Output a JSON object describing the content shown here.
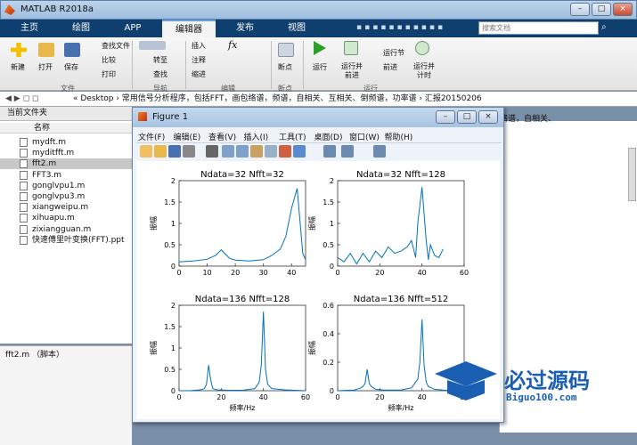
{
  "window": {
    "title": "MATLAB R2018a",
    "buttons": [
      "–",
      "□",
      "×"
    ]
  },
  "tabs": [
    "主页",
    "绘图",
    "APP",
    "编辑器",
    "发布",
    "视图"
  ],
  "search": {
    "placeholder": "搜索文档"
  },
  "ribbon": {
    "file": {
      "new": "新建",
      "open": "打开",
      "save": "保存",
      "find_files": "查找文件",
      "compare": "比较",
      "print": "打印",
      "group": "文件"
    },
    "nav": {
      "goto": "转至",
      "find": "查找",
      "group": "导航"
    },
    "edit": {
      "insert": "插入",
      "comment": "注释",
      "indent": "缩进",
      "group": "编辑"
    },
    "breakpoints": {
      "label": "断点",
      "group": "断点"
    },
    "run": {
      "run": "运行",
      "run_advance": "运行并\n前进",
      "run_section": "运行节",
      "advance": "前进",
      "run_time": "运行并\n计时",
      "group": "运行"
    }
  },
  "address": "« Desktop › 常用信号分析程序，包括FFT，画包络谱，频谱，自相关、互相关、倒频谱，功率谱 › 汇报20150206",
  "current_folder": {
    "title": "当前文件夹",
    "col": "名称",
    "files": [
      "mydft.m",
      "myditfft.m",
      "fft2.m",
      "FFT3.m",
      "gonglvpu1.m",
      "gonglvpu3.m",
      "xiangweipu.m",
      "xihuapu.m",
      "zixiangguan.m",
      "快速傅里叶变换(FFT).ppt"
    ],
    "selected": 2,
    "details": "fft2.m （脚本）"
  },
  "right_snippet": "络谱，自相关、",
  "figure": {
    "title": "Figure 1",
    "menu": [
      "文件(F)",
      "编辑(E)",
      "查看(V)",
      "插入(I)",
      "工具(T)",
      "桌面(D)",
      "窗口(W)",
      "帮助(H)"
    ]
  },
  "chart_data": [
    {
      "type": "line",
      "title": "Ndata=32 Nfft=32",
      "xlabel": "",
      "ylabel": "振幅",
      "xlim": [
        0,
        45
      ],
      "ylim": [
        0,
        2
      ],
      "xticks": [
        0,
        10,
        20,
        30,
        40
      ],
      "yticks": [
        0,
        0.5,
        1,
        1.5,
        2
      ],
      "series": [
        {
          "x": [
            0,
            5,
            10,
            13,
            15,
            18,
            20,
            25,
            30,
            33,
            36,
            38,
            40,
            42,
            44,
            45
          ],
          "y": [
            0.1,
            0.12,
            0.16,
            0.25,
            0.38,
            0.18,
            0.14,
            0.12,
            0.15,
            0.25,
            0.4,
            0.7,
            1.35,
            1.82,
            0.3,
            0.15
          ]
        }
      ]
    },
    {
      "type": "line",
      "title": "Ndata=32 Nfft=128",
      "xlabel": "",
      "ylabel": "振幅",
      "xlim": [
        0,
        60
      ],
      "ylim": [
        0,
        2
      ],
      "xticks": [
        0,
        20,
        40,
        60
      ],
      "yticks": [
        0,
        0.5,
        1,
        1.5,
        2
      ],
      "series": [
        {
          "x": [
            0,
            3,
            6,
            9,
            12,
            15,
            18,
            21,
            24,
            27,
            30,
            33,
            35,
            37,
            38,
            40,
            42,
            43,
            44,
            46,
            48,
            50
          ],
          "y": [
            0.2,
            0.1,
            0.3,
            0.05,
            0.3,
            0.1,
            0.35,
            0.2,
            0.45,
            0.3,
            0.35,
            0.45,
            0.6,
            0.2,
            1.0,
            1.85,
            0.6,
            0.15,
            0.5,
            0.25,
            0.2,
            0.4
          ]
        }
      ]
    },
    {
      "type": "line",
      "title": "Ndata=136 Nfft=128",
      "xlabel": "频率/Hz",
      "ylabel": "振幅",
      "xlim": [
        0,
        60
      ],
      "ylim": [
        0,
        2
      ],
      "xticks": [
        0,
        20,
        40,
        60
      ],
      "yticks": [
        0,
        0.5,
        1,
        1.5,
        2
      ],
      "series": [
        {
          "x": [
            0,
            5,
            10,
            12,
            13,
            14,
            15,
            16,
            18,
            25,
            30,
            36,
            38,
            39,
            40,
            41,
            42,
            44,
            50,
            60
          ],
          "y": [
            0,
            0,
            0.02,
            0.05,
            0.15,
            0.6,
            0.25,
            0.05,
            0.02,
            0.01,
            0.01,
            0.05,
            0.2,
            0.6,
            1.85,
            0.5,
            0.15,
            0.05,
            0.02,
            0
          ]
        }
      ]
    },
    {
      "type": "line",
      "title": "Ndata=136 Nfft=512",
      "xlabel": "频率/Hz",
      "ylabel": "振幅",
      "xlim": [
        0,
        60
      ],
      "ylim": [
        0,
        0.6
      ],
      "xticks": [
        0,
        20,
        40,
        60
      ],
      "yticks": [
        0,
        0.2,
        0.4,
        0.6
      ],
      "series": [
        {
          "x": [
            0,
            8,
            11,
            12,
            13,
            14,
            15,
            16,
            17,
            18,
            22,
            30,
            35,
            38,
            39,
            40,
            41,
            42,
            43,
            46,
            50,
            60
          ],
          "y": [
            0,
            0.005,
            0.02,
            0.03,
            0.05,
            0.15,
            0.05,
            0.03,
            0.02,
            0.01,
            0.005,
            0.005,
            0.02,
            0.08,
            0.2,
            0.5,
            0.18,
            0.06,
            0.03,
            0.01,
            0.005,
            0
          ]
        }
      ]
    }
  ],
  "banner": {
    "brand": "必过源码",
    "url": "Biguo100.com"
  }
}
